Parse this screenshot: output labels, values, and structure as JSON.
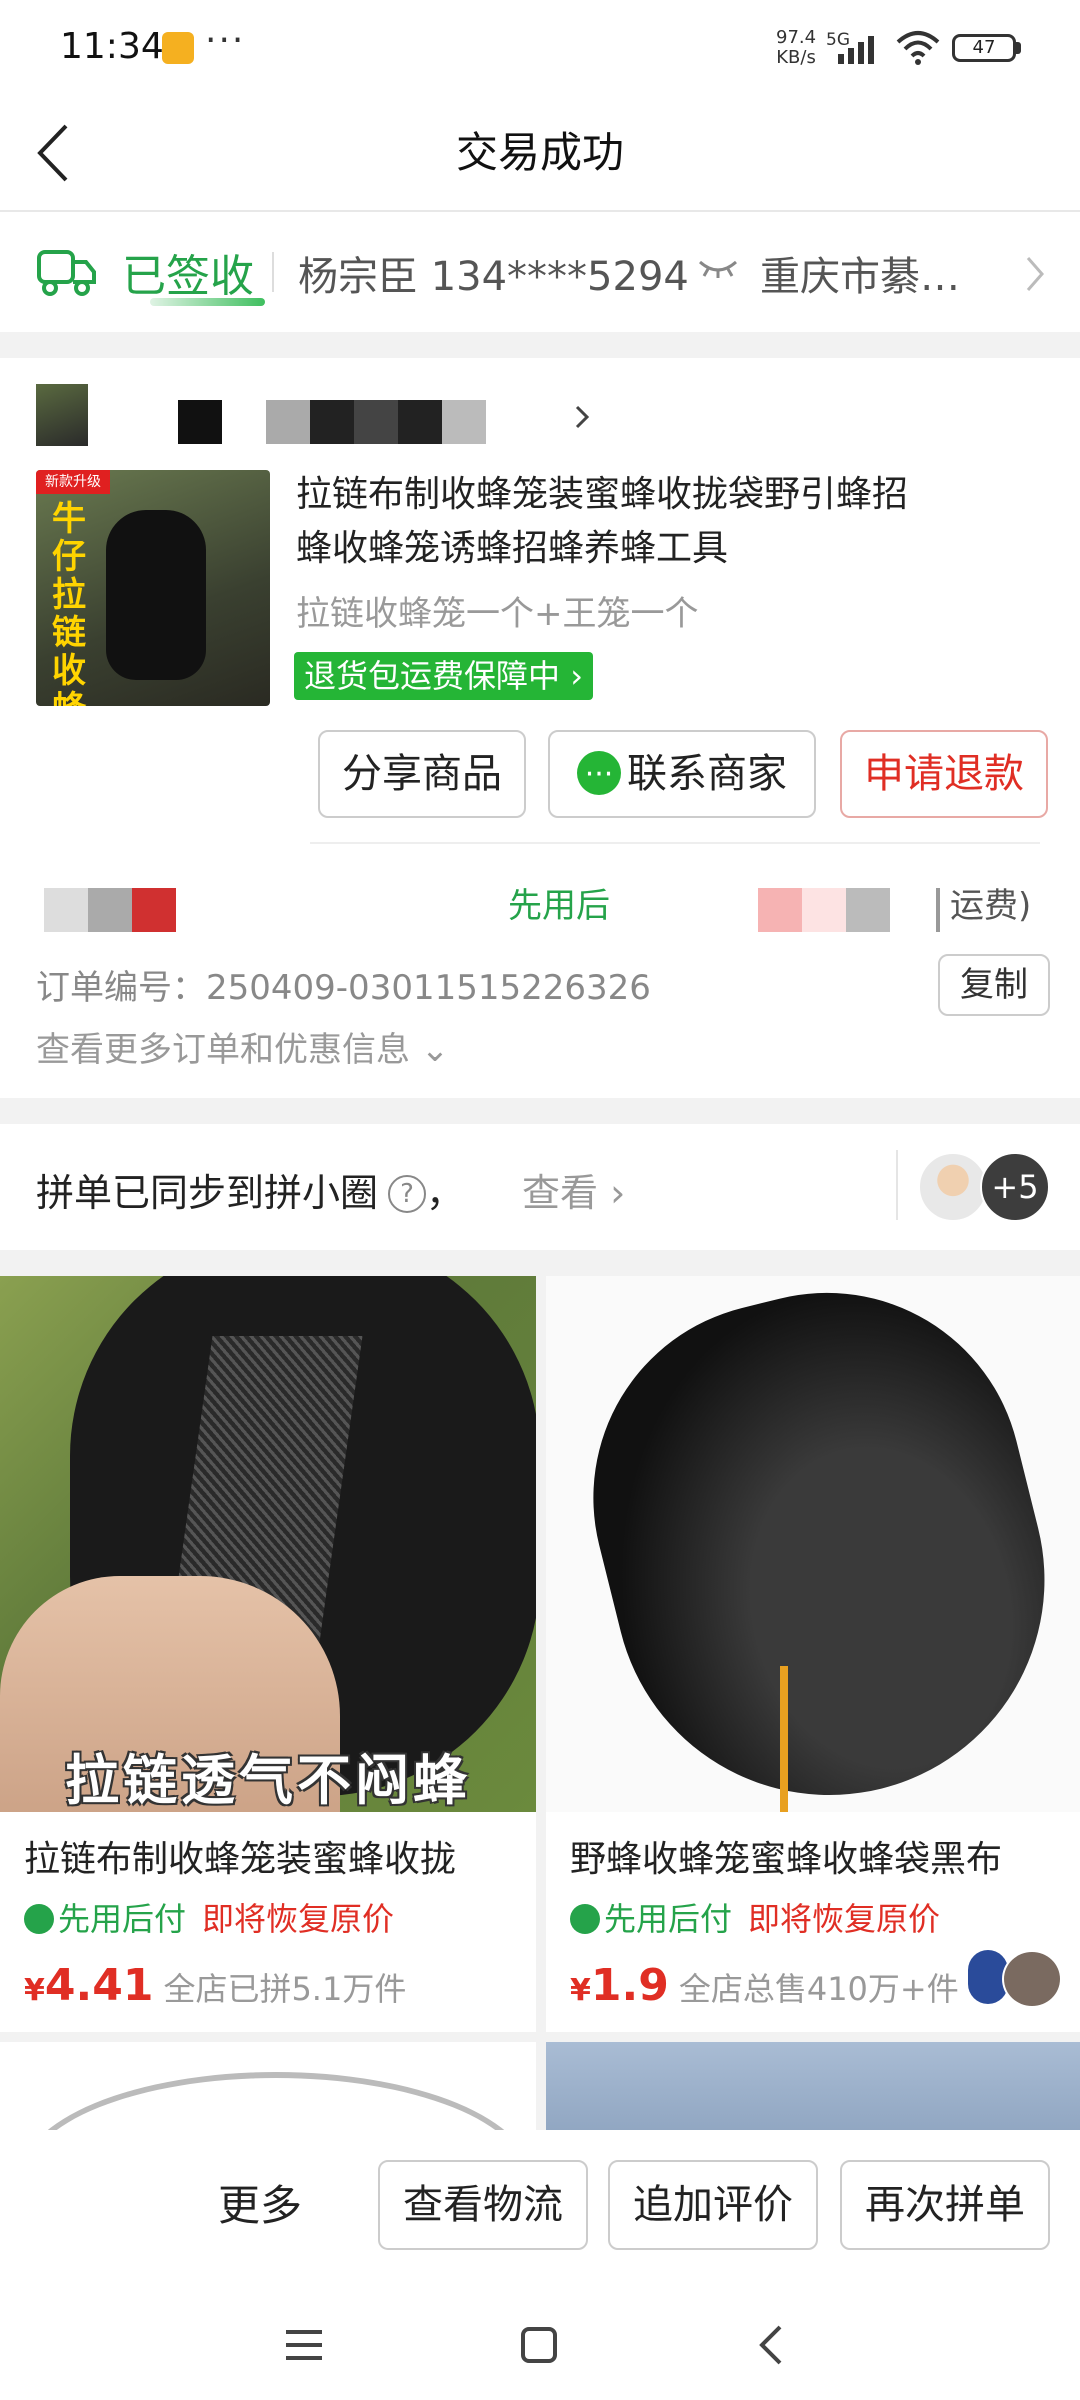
{
  "status_bar": {
    "time": "11:34",
    "more": "···",
    "net_speed": "97.4",
    "net_unit": "KB/s",
    "network": "5G",
    "battery": "47"
  },
  "nav": {
    "title": "交易成功"
  },
  "logistics": {
    "status": "已签收",
    "receiver": "杨宗臣 134****5294",
    "address": "重庆市綦…"
  },
  "order": {
    "product_title": "拉链布制收蜂笼装蜜蜂收拢袋野引蜂招蜂收蜂笼诱蜂招蜂养蜂工具",
    "spec": "拉链收蜂笼一个+王笼一个",
    "guarantee": "退货包运费保障中",
    "thumb_badge": "新款升级",
    "thumb_text": "牛仔拉链收蜂笼",
    "share_label": "分享商品",
    "contact_label": "联系商家",
    "refund_label": "申请退款",
    "payment_label": "先用后",
    "freight_label": "运费)",
    "order_no": "订单编号：250409-03011515226326",
    "copy_label": "复制",
    "more_info": "查看更多订单和优惠信息"
  },
  "pin_circle": {
    "text": "拼单已同步到拼小圈",
    "help": "?",
    "comma": "，",
    "view": "查看",
    "extra_count": "+5"
  },
  "recommendations": [
    {
      "caption": "拉链透气不闷蜂",
      "title": "拉链布制收蜂笼装蜜蜂收拢",
      "badge": "先用后付",
      "restore": "即将恢复原价",
      "currency": "¥",
      "price": "4.41",
      "sales": "全店已拼5.1万件"
    },
    {
      "title": "野蜂收蜂笼蜜蜂收蜂袋黑布",
      "badge": "先用后付",
      "restore": "即将恢复原价",
      "currency": "¥",
      "price": "1.9",
      "sales": "全店总售410万+件"
    }
  ],
  "bottom_bar": {
    "more": "更多",
    "logistics": "查看物流",
    "review": "追加评价",
    "reorder": "再次拼单"
  },
  "colors": {
    "green": "#25a34a",
    "red": "#e02e24",
    "badge_green": "#25b536"
  }
}
